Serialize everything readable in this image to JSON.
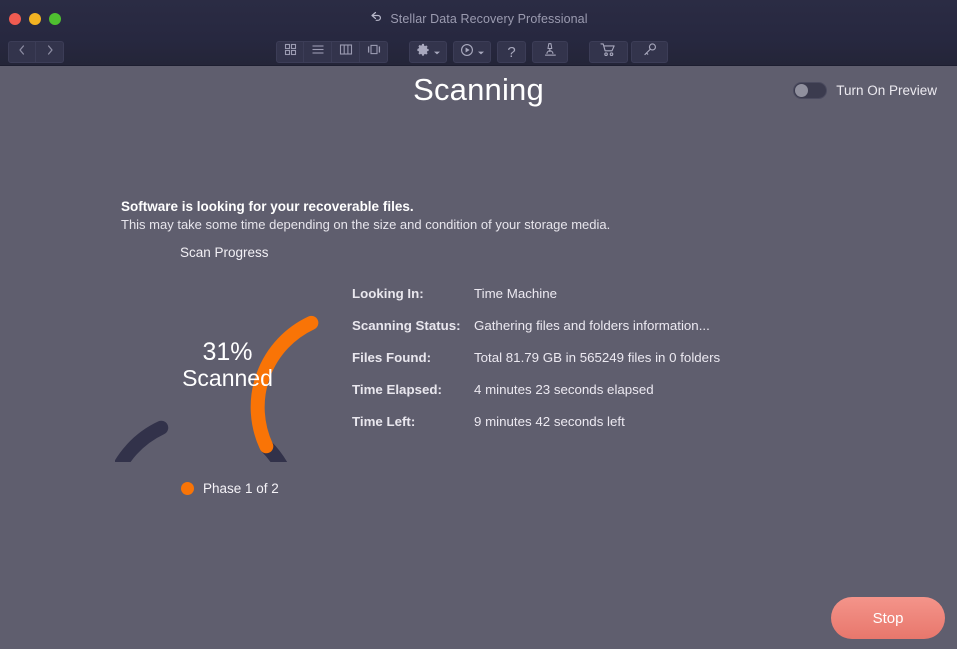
{
  "window": {
    "title": "Stellar Data Recovery Professional",
    "back_icon": "return-arrow-icon",
    "traffic_lights": [
      "close",
      "minimize",
      "zoom"
    ]
  },
  "toolbar": {
    "nav": [
      {
        "name": "back-button",
        "icon": "chevron-left-icon"
      },
      {
        "name": "forward-button",
        "icon": "chevron-right-icon"
      }
    ],
    "view_modes": [
      {
        "name": "icon-view-button",
        "icon": "grid-icon"
      },
      {
        "name": "list-view-button",
        "icon": "list-icon"
      },
      {
        "name": "column-view-button",
        "icon": "columns-icon"
      },
      {
        "name": "gallery-view-button",
        "icon": "gallery-icon"
      }
    ],
    "actions": [
      {
        "name": "settings-button",
        "icon": "gear-icon",
        "has_dropdown": true
      },
      {
        "name": "history-button",
        "icon": "disc-icon",
        "has_dropdown": true
      },
      {
        "name": "help-button",
        "icon": "question-mark-icon",
        "has_dropdown": false
      },
      {
        "name": "preview-scan-button",
        "icon": "microscope-icon",
        "has_dropdown": false
      }
    ],
    "store": [
      {
        "name": "cart-button",
        "icon": "shopping-cart-icon"
      },
      {
        "name": "activate-button",
        "icon": "key-icon"
      }
    ]
  },
  "header": {
    "title": "Scanning",
    "preview_toggle": {
      "label": "Turn On Preview",
      "state": "off"
    }
  },
  "body": {
    "headline": "Software is looking for your recoverable files.",
    "subtext": "This may take some time depending on the size and condition of your storage media."
  },
  "gauge": {
    "label": "Scan Progress",
    "percent_text": "31%",
    "state_text": "Scanned",
    "percent_value": 31,
    "track_color": "#32324a",
    "progress_color": "#f97406"
  },
  "phase": {
    "dot_color": "#f97406",
    "text": "Phase 1 of 2"
  },
  "details": [
    {
      "label": "Looking In:",
      "value": "Time Machine"
    },
    {
      "label": "Scanning Status:",
      "value": "Gathering files and folders information..."
    },
    {
      "label": "Files Found:",
      "value": "Total 81.79 GB in 565249 files in 0 folders"
    },
    {
      "label": "Time Elapsed:",
      "value": "4 minutes 23 seconds elapsed"
    },
    {
      "label": "Time Left:",
      "value": "9 minutes 42 seconds left"
    }
  ],
  "footer": {
    "stop_label": "Stop"
  }
}
